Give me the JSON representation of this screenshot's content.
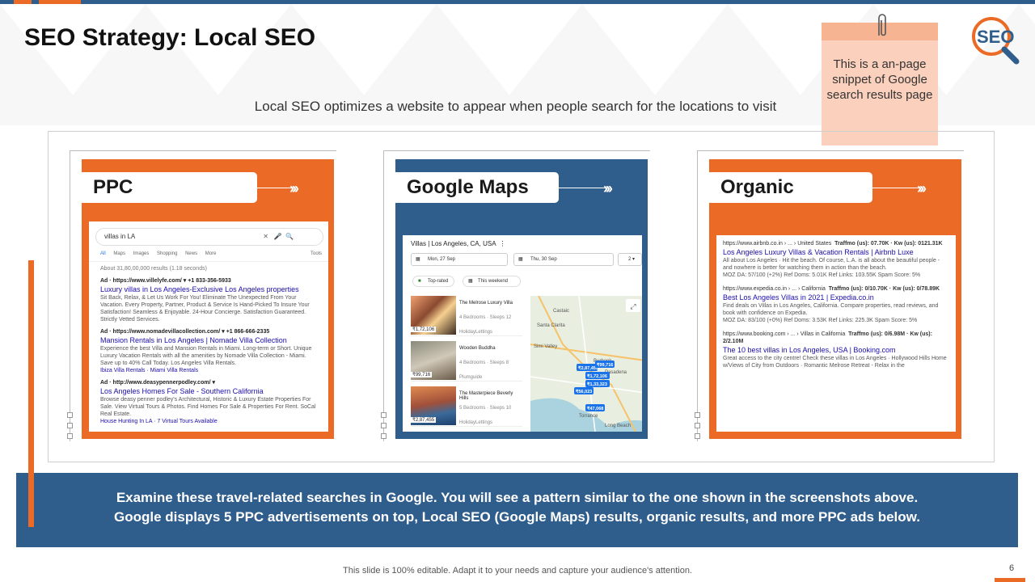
{
  "slide": {
    "title": "SEO Strategy: Local SEO",
    "subtitle": "Local SEO optimizes a website to appear when people search for the locations to visit",
    "note": "This is a an-page snippet of Google search results page",
    "logo_text": "SEO",
    "footer": "This slide is 100% editable. Adapt it to your needs and capture your audience's attention.",
    "page_number": "6",
    "banner_line1": "Examine these travel-related searches in Google. You will see a pattern similar to the one shown in the screenshots above.",
    "banner_line2": "Google displays 5 PPC advertisements on top, Local SEO (Google Maps) results, organic results, and more PPC ads below."
  },
  "colors": {
    "orange": "#ea6a26",
    "blue": "#2f5d8c",
    "note": "#fbd1bd"
  },
  "cards": [
    {
      "label": "PPC",
      "arrows": "›››"
    },
    {
      "label": "Google Maps",
      "arrows": "›››"
    },
    {
      "label": "Organic",
      "arrows": "›››"
    }
  ],
  "ppc": {
    "query": "villas in LA",
    "tabs": [
      "All",
      "Maps",
      "Images",
      "Shopping",
      "News",
      "More",
      "Tools"
    ],
    "stats": "About 31,80,00,000 results (1.18 seconds)",
    "ads": [
      {
        "url": "Ad · https://www.villelyfe.com/ ▾ +1 833-356-5933",
        "title": "Luxury villas in Los Angeles-Exclusive Los Angeles properties",
        "desc": "Sit Back, Relax, & Let Us Work For You! Eliminate The Unexpected From Your Vacation. Every Property, Partner, Product & Service Is Hand-Picked To Insure Your Satisfaction! Seamless & Enjoyable. 24-Hour Concierge. Satisfaction Guaranteed. Strictly Vetted Services."
      },
      {
        "url": "Ad · https://www.nomadevillacollection.com/ ▾ +1 866-666-2335",
        "title": "Mansion Rentals in Los Angeles | Nomade Villa Collection",
        "desc": "Experience the best Villa and Mansion Rentals in Miami. Long-term or Short. Unique Luxury Vacation Rentals with all the amenities by Nomade Villa Collection - Miami. Save up to 40% Call Today. Los Angeles Villa Rentals.",
        "sitelinks": "Ibiza Villa Rentals · Miami Villa Rentals"
      },
      {
        "url": "Ad · http://www.deasypennerpodley.com/ ▾",
        "title": "Los Angeles Homes For Sale - Southern California",
        "desc": "Browse deasy penner podley's Architectural, Historic & Luxury Estate Properties For Sale. View Virtual Tours & Photos. Find Homes For Sale & Properties For Rent. SoCal Real Estate.",
        "sitelinks": "House Hunting In LA · 7 Virtual Tours Available"
      }
    ]
  },
  "maps": {
    "header": "Villas | Los Angeles, CA, USA",
    "checkin": "Mon, 27 Sep",
    "checkout": "Thu, 30 Sep",
    "guests": "2",
    "chip1": "Top-rated",
    "chip2": "This weekend",
    "hotels": [
      {
        "name": "The Melrose Luxury Villa",
        "info": "4 Bedrooms · Sleeps 12",
        "host": "HolidayLettings",
        "price": "₹1,72,106"
      },
      {
        "name": "Wooden Buddha",
        "info": "4 Bedrooms · Sleeps 8",
        "host": "Plumguide",
        "price": "₹99,716"
      },
      {
        "name": "The Masterpiece Beverly Hills",
        "info": "5 Bedrooms · Sleeps 10",
        "host": "HolidayLettings",
        "price": "₹2,87,455"
      }
    ],
    "map_places": [
      "Castaic",
      "Santa Clarita",
      "Simi Valley",
      "Burbank",
      "Pasadena",
      "Torrance",
      "Long Beach"
    ],
    "map_prices": [
      "₹2,87,455",
      "₹99,716",
      "₹1,72,106",
      "₹1,33,323",
      "₹56,023",
      "₹47,068"
    ]
  },
  "organic": {
    "results": [
      {
        "url": "https://www.airbnb.co.in › ... › United States",
        "metrics": "Traffmo (us): 07.70K · Kw (us): 0121.31K",
        "title": "Los Angeles Luxury Villas & Vacation Rentals | Airbnb Luxe",
        "desc": "All about Los Angeles · Hit the beach. Of course, L.A. is all about the beautiful people - and nowhere is better for watching them in action than the beach.",
        "moz": "MOZ DA: 57/100 (+2%)  Ref Doms: 5.01K  Ref Links: 103.55K  Spam Score: 5%"
      },
      {
        "url": "https://www.expedia.co.in › ... › California",
        "metrics": "Traffmo (us): 0/10.70K · Kw (us): 0/78.89K",
        "title": "Best Los Angeles Villas in 2021 | Expedia.co.in",
        "desc": "Find deals on Villas in Los Angeles, California. Compare properties, read reviews, and book with confidence on Expedia.",
        "moz": "MOZ DA: 83/100 (+0%)  Ref Doms: 3.53K  Ref Links: 225.3K  Spam Score: 5%"
      },
      {
        "url": "https://www.booking.com › ... › Villas in California",
        "metrics": "Traffmo (us): 0/6.98M · Kw (us): 2/2.10M",
        "title": "The 10 best villas in Los Angeles, USA | Booking.com",
        "desc": "Great access to the city centre! Check these villas in Los Angeles · Hollywood Hills Home w/Views of City from Outdoors · Romantic Melrose Retreat - Relax in the"
      }
    ]
  }
}
